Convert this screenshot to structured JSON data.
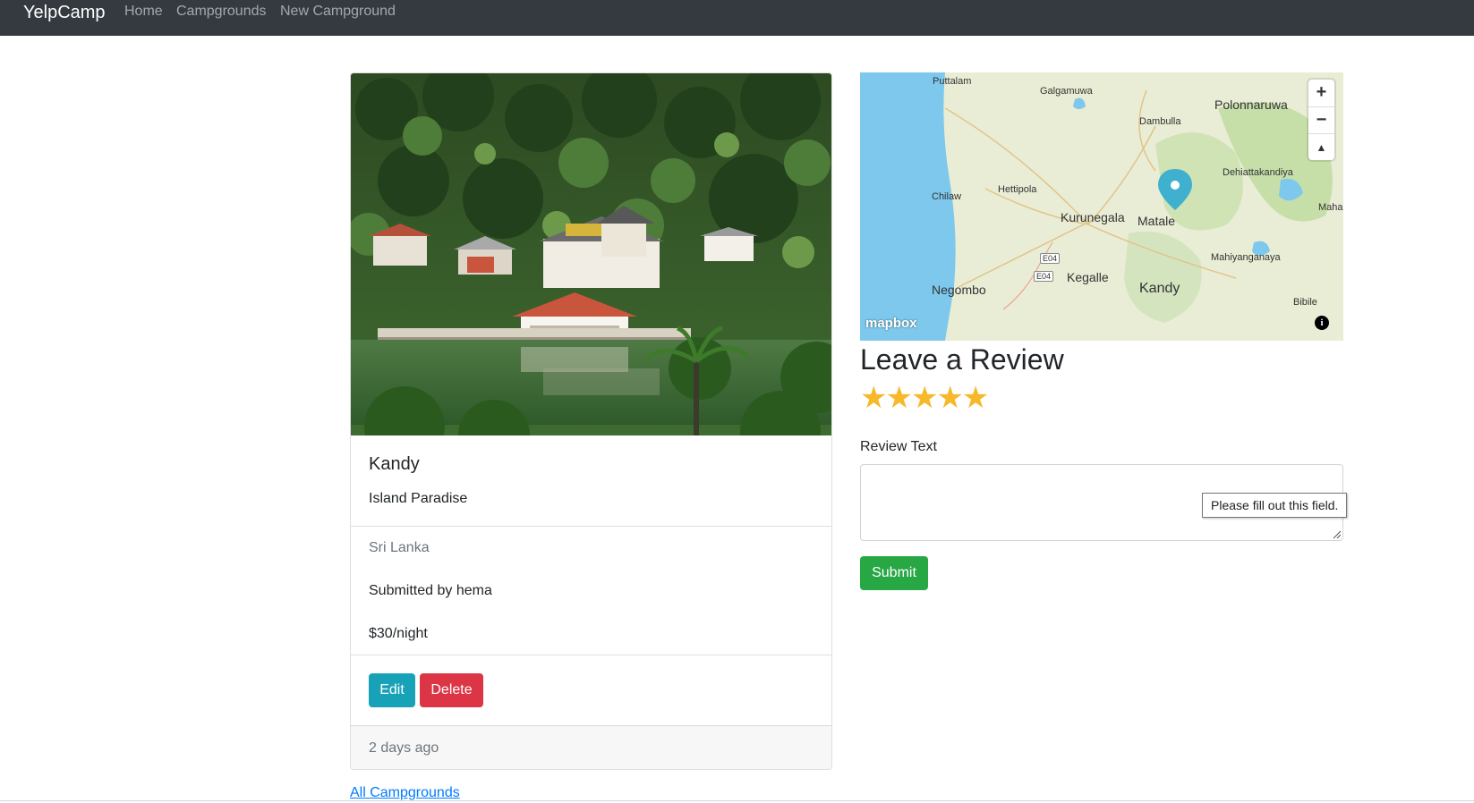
{
  "navbar": {
    "brand": "YelpCamp",
    "links": [
      "Home",
      "Campgrounds",
      "New Campground"
    ]
  },
  "campground": {
    "title": "Kandy",
    "description": "Island Paradise",
    "location": "Sri Lanka",
    "submitted_by": "Submitted by hema",
    "price": "$30/night",
    "edit_label": "Edit",
    "delete_label": "Delete",
    "posted": "2 days ago"
  },
  "all_campgrounds_link": "All Campgrounds",
  "map": {
    "labels": [
      "Puttalam",
      "Galgamuwa",
      "Polonnaruwa",
      "Dambulla",
      "Dehiattakandiya",
      "Chilaw",
      "Hettipola",
      "Kurunegala",
      "Matale",
      "Maha",
      "Mahiyanganaya",
      "E04",
      "E04",
      "Kegalle",
      "Negombo",
      "Kandy",
      "Bibile"
    ],
    "zoom_in": "+",
    "zoom_out": "−",
    "compass": "▲",
    "attribution_logo": "mapbox",
    "info": "i"
  },
  "review": {
    "heading": "Leave a Review",
    "stars": "★★★★★",
    "rating": 5,
    "text_label": "Review Text",
    "validation_tooltip": "Please fill out this field.",
    "submit_label": "Submit"
  }
}
